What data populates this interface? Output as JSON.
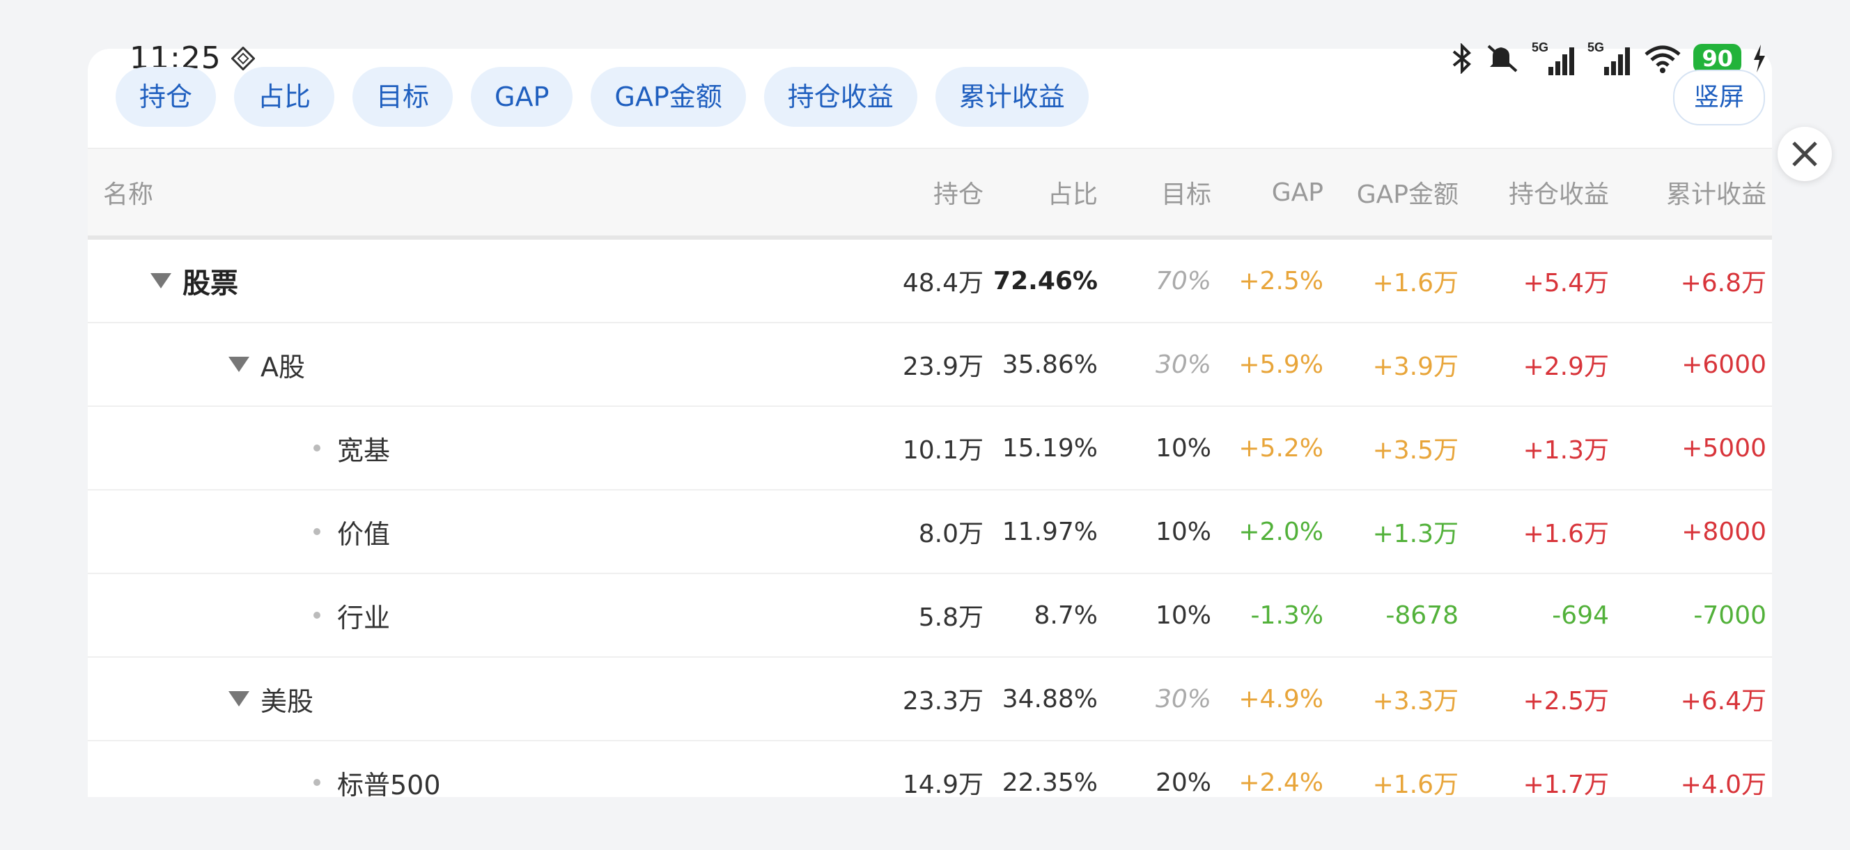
{
  "status": {
    "time": "11:25",
    "battery": "90"
  },
  "tabs": [
    "持仓",
    "占比",
    "目标",
    "GAP",
    "GAP金额",
    "持仓收益",
    "累计收益"
  ],
  "portrait_label": "竖屏",
  "headers": {
    "name": "名称",
    "holding": "持仓",
    "ratio": "占比",
    "target": "目标",
    "gap": "GAP",
    "gap_amount": "GAP金额",
    "holding_profit": "持仓收益",
    "total_profit": "累计收益"
  },
  "rows": [
    {
      "name": "股票",
      "holding": "48.4万",
      "ratio": "72.46%",
      "target": "70%",
      "gap": "+2.5%",
      "gap_amount": "+1.6万",
      "holding_profit": "+5.4万",
      "total_profit": "+6.8万"
    },
    {
      "name": "A股",
      "holding": "23.9万",
      "ratio": "35.86%",
      "target": "30%",
      "gap": "+5.9%",
      "gap_amount": "+3.9万",
      "holding_profit": "+2.9万",
      "total_profit": "+6000"
    },
    {
      "name": "宽基",
      "holding": "10.1万",
      "ratio": "15.19%",
      "target": "10%",
      "gap": "+5.2%",
      "gap_amount": "+3.5万",
      "holding_profit": "+1.3万",
      "total_profit": "+5000"
    },
    {
      "name": "价值",
      "holding": "8.0万",
      "ratio": "11.97%",
      "target": "10%",
      "gap": "+2.0%",
      "gap_amount": "+1.3万",
      "holding_profit": "+1.6万",
      "total_profit": "+8000"
    },
    {
      "name": "行业",
      "holding": "5.8万",
      "ratio": "8.7%",
      "target": "10%",
      "gap": "-1.3%",
      "gap_amount": "-8678",
      "holding_profit": "-694",
      "total_profit": "-7000"
    },
    {
      "name": "美股",
      "holding": "23.3万",
      "ratio": "34.88%",
      "target": "30%",
      "gap": "+4.9%",
      "gap_amount": "+3.3万",
      "holding_profit": "+2.5万",
      "total_profit": "+6.4万"
    },
    {
      "name": "标普500",
      "holding": "14.9万",
      "ratio": "22.35%",
      "target": "20%",
      "gap": "+2.4%",
      "gap_amount": "+1.6万",
      "holding_profit": "+1.7万",
      "total_profit": "+4.0万"
    }
  ],
  "colors": {
    "accent": "#1f5fbf",
    "positive_gap": "#e8a53a",
    "green": "#52b13a",
    "red": "#d8343a"
  }
}
